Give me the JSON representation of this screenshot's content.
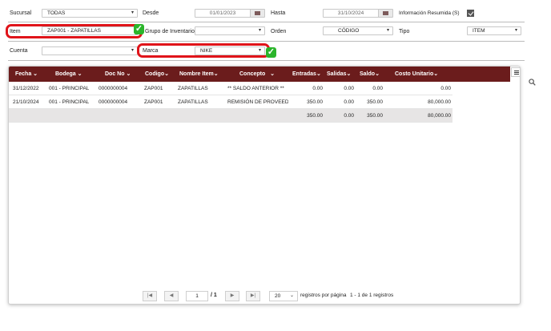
{
  "filters": {
    "sucursal": {
      "label": "Sucursal",
      "value": "TODAS"
    },
    "desde": {
      "label": "Desde",
      "value": "01/01/2023"
    },
    "hasta": {
      "label": "Hasta",
      "value": "31/10/2024"
    },
    "informacion_resumida": {
      "label": "Información Resumida (S)",
      "checked": true
    },
    "item": {
      "label": "Item",
      "value": "ZAP001 - ZAPATILLAS"
    },
    "grupo_inventario": {
      "label": "Grupo de Inventario",
      "value": ""
    },
    "orden": {
      "label": "Orden",
      "value": "CÓDIGO"
    },
    "tipo": {
      "label": "Tipo",
      "value": "ITEM"
    },
    "cuenta": {
      "label": "Cuenta",
      "value": ""
    },
    "marca": {
      "label": "Marca",
      "value": "NIKE"
    }
  },
  "table": {
    "columns": [
      "Fecha",
      "Bodega",
      "Doc No",
      "Codigo",
      "Nombre Item",
      "Concepto",
      "Entradas",
      "Salidas",
      "Saldo",
      "Costo Unitario"
    ],
    "rows": [
      [
        "31/12/2022",
        "001 - PRINCIPAL",
        "0000000004",
        "ZAP001",
        "ZAPATILLAS",
        "** SALDO ANTERIOR **",
        "0.00",
        "0.00",
        "0.00",
        "0.00"
      ],
      [
        "21/10/2024",
        "001 - PRINCIPAL",
        "0000000004",
        "ZAP001",
        "ZAPATILLAS",
        "REMISIÓN DE PROVEEDOR",
        "350.00",
        "0.00",
        "350.00",
        "80,000.00"
      ]
    ],
    "totals": [
      "350.00",
      "0.00",
      "350.00",
      "80,000.00"
    ]
  },
  "pager": {
    "page": "1",
    "of_pages": "/ 1",
    "page_size": "20",
    "per_page_label": "registros por página",
    "summary": "1 - 1 de 1 registros"
  },
  "colors": {
    "header": "#6b1c1c",
    "highlight": "#e0141a",
    "check": "#2bb52b"
  },
  "icons": [
    "chevron-down-icon",
    "calendar-icon",
    "checkbox-checked-icon",
    "check-icon",
    "menu-icon",
    "search-icon",
    "first-page-icon",
    "prev-page-icon",
    "next-page-icon",
    "last-page-icon"
  ]
}
